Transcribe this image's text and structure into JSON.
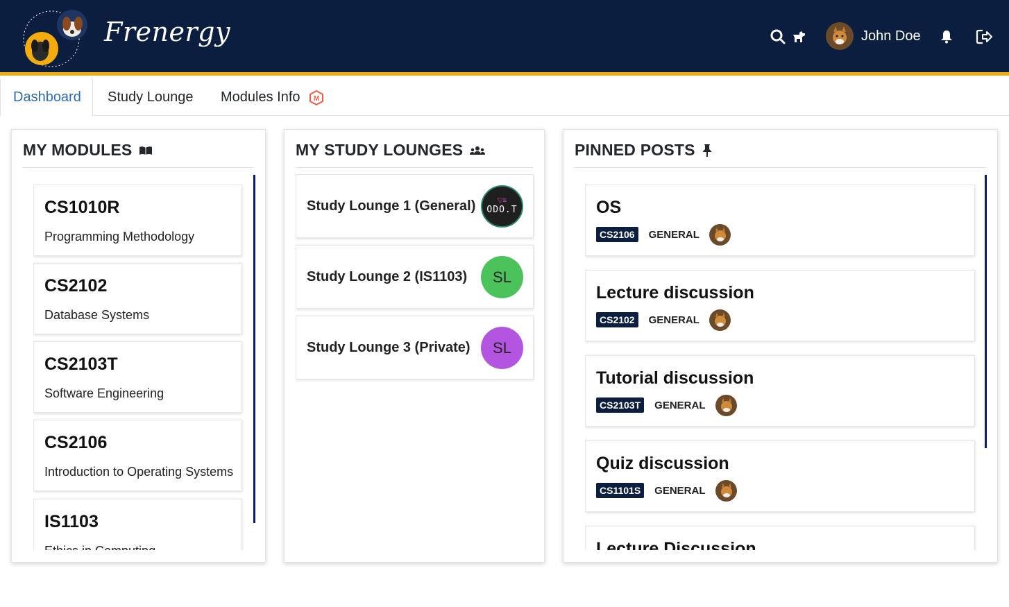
{
  "header": {
    "brand": "Frenergy",
    "user_name": "John Doe"
  },
  "tabs": [
    {
      "label": "Dashboard",
      "active": true
    },
    {
      "label": "Study Lounge",
      "active": false
    },
    {
      "label": "Modules Info",
      "active": false
    }
  ],
  "modules_panel": {
    "title": "MY MODULES",
    "items": [
      {
        "code": "CS1010R",
        "name": "Programming Methodology"
      },
      {
        "code": "CS2102",
        "name": "Database Systems"
      },
      {
        "code": "CS2103T",
        "name": "Software Engineering"
      },
      {
        "code": "CS2106",
        "name": "Introduction to Operating Systems"
      },
      {
        "code": "IS1103",
        "name": "Ethics in Computing"
      }
    ]
  },
  "lounges_panel": {
    "title": "MY STUDY LOUNGES",
    "items": [
      {
        "name": "Study Lounge 1 (General)",
        "avatar_text": "ODO.T",
        "avatar_color": "#1f1f1f"
      },
      {
        "name": "Study Lounge 2 (IS1103)",
        "avatar_text": "SL",
        "avatar_color": "#4cc35a"
      },
      {
        "name": "Study Lounge 3 (Private)",
        "avatar_text": "SL",
        "avatar_color": "#b355e0"
      }
    ]
  },
  "posts_panel": {
    "title": "PINNED POSTS",
    "items": [
      {
        "title": "OS",
        "module": "CS2106",
        "category": "GENERAL"
      },
      {
        "title": "Lecture discussion",
        "module": "CS2102",
        "category": "GENERAL"
      },
      {
        "title": "Tutorial discussion",
        "module": "CS2103T",
        "category": "GENERAL"
      },
      {
        "title": "Quiz discussion",
        "module": "CS1101S",
        "category": "GENERAL"
      },
      {
        "title": "Lecture Discussion",
        "module": "",
        "category": ""
      }
    ]
  },
  "colors": {
    "header_bg": "#0b1e3f",
    "header_accent": "#f2ac0d",
    "active_tab": "#2d6cb0",
    "scrollbar": "#0a1a70"
  }
}
